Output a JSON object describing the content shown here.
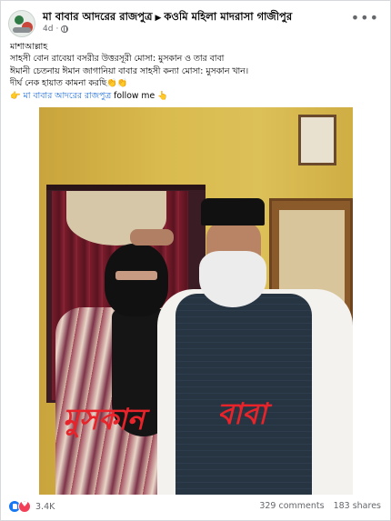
{
  "post": {
    "page_name": "মা বাবার আদরের রাজপুত্র",
    "group_name": "কওমি মহিলা মাদরাসা গাজীপুর",
    "time": "4d",
    "text_lines": [
      "মাশাআল্লাহ",
      "সাহসী বোন রাবেয়া বসরীর উত্তরসূরী মোসা: মুসকান ও তার বাবা",
      "ঈমানী চেতনায় ঈমান জাগানিয়া বাবার সাহসী কন্যা মোসা: মুসকান খান।",
      "দীর্ঘ নেক হায়াত কামনা করছি👏👏"
    ],
    "follow_prefix": "👉",
    "follow_link": "মা বাবার আদরের রাজপুত্র",
    "follow_suffix": "follow me 👆"
  },
  "photo": {
    "label_girl": "মুসকান",
    "label_father": "বাবা"
  },
  "footer": {
    "reactions_count": "3.4K",
    "comments": "329 comments",
    "shares": "183 shares"
  },
  "icons": {
    "like": "like-icon",
    "love": "love-icon",
    "globe": "globe-icon",
    "more": "more-icon"
  },
  "colors": {
    "link": "#216fdb",
    "label_red": "#e8232a",
    "like_blue": "#1877f2",
    "love_red": "#f33e58"
  }
}
